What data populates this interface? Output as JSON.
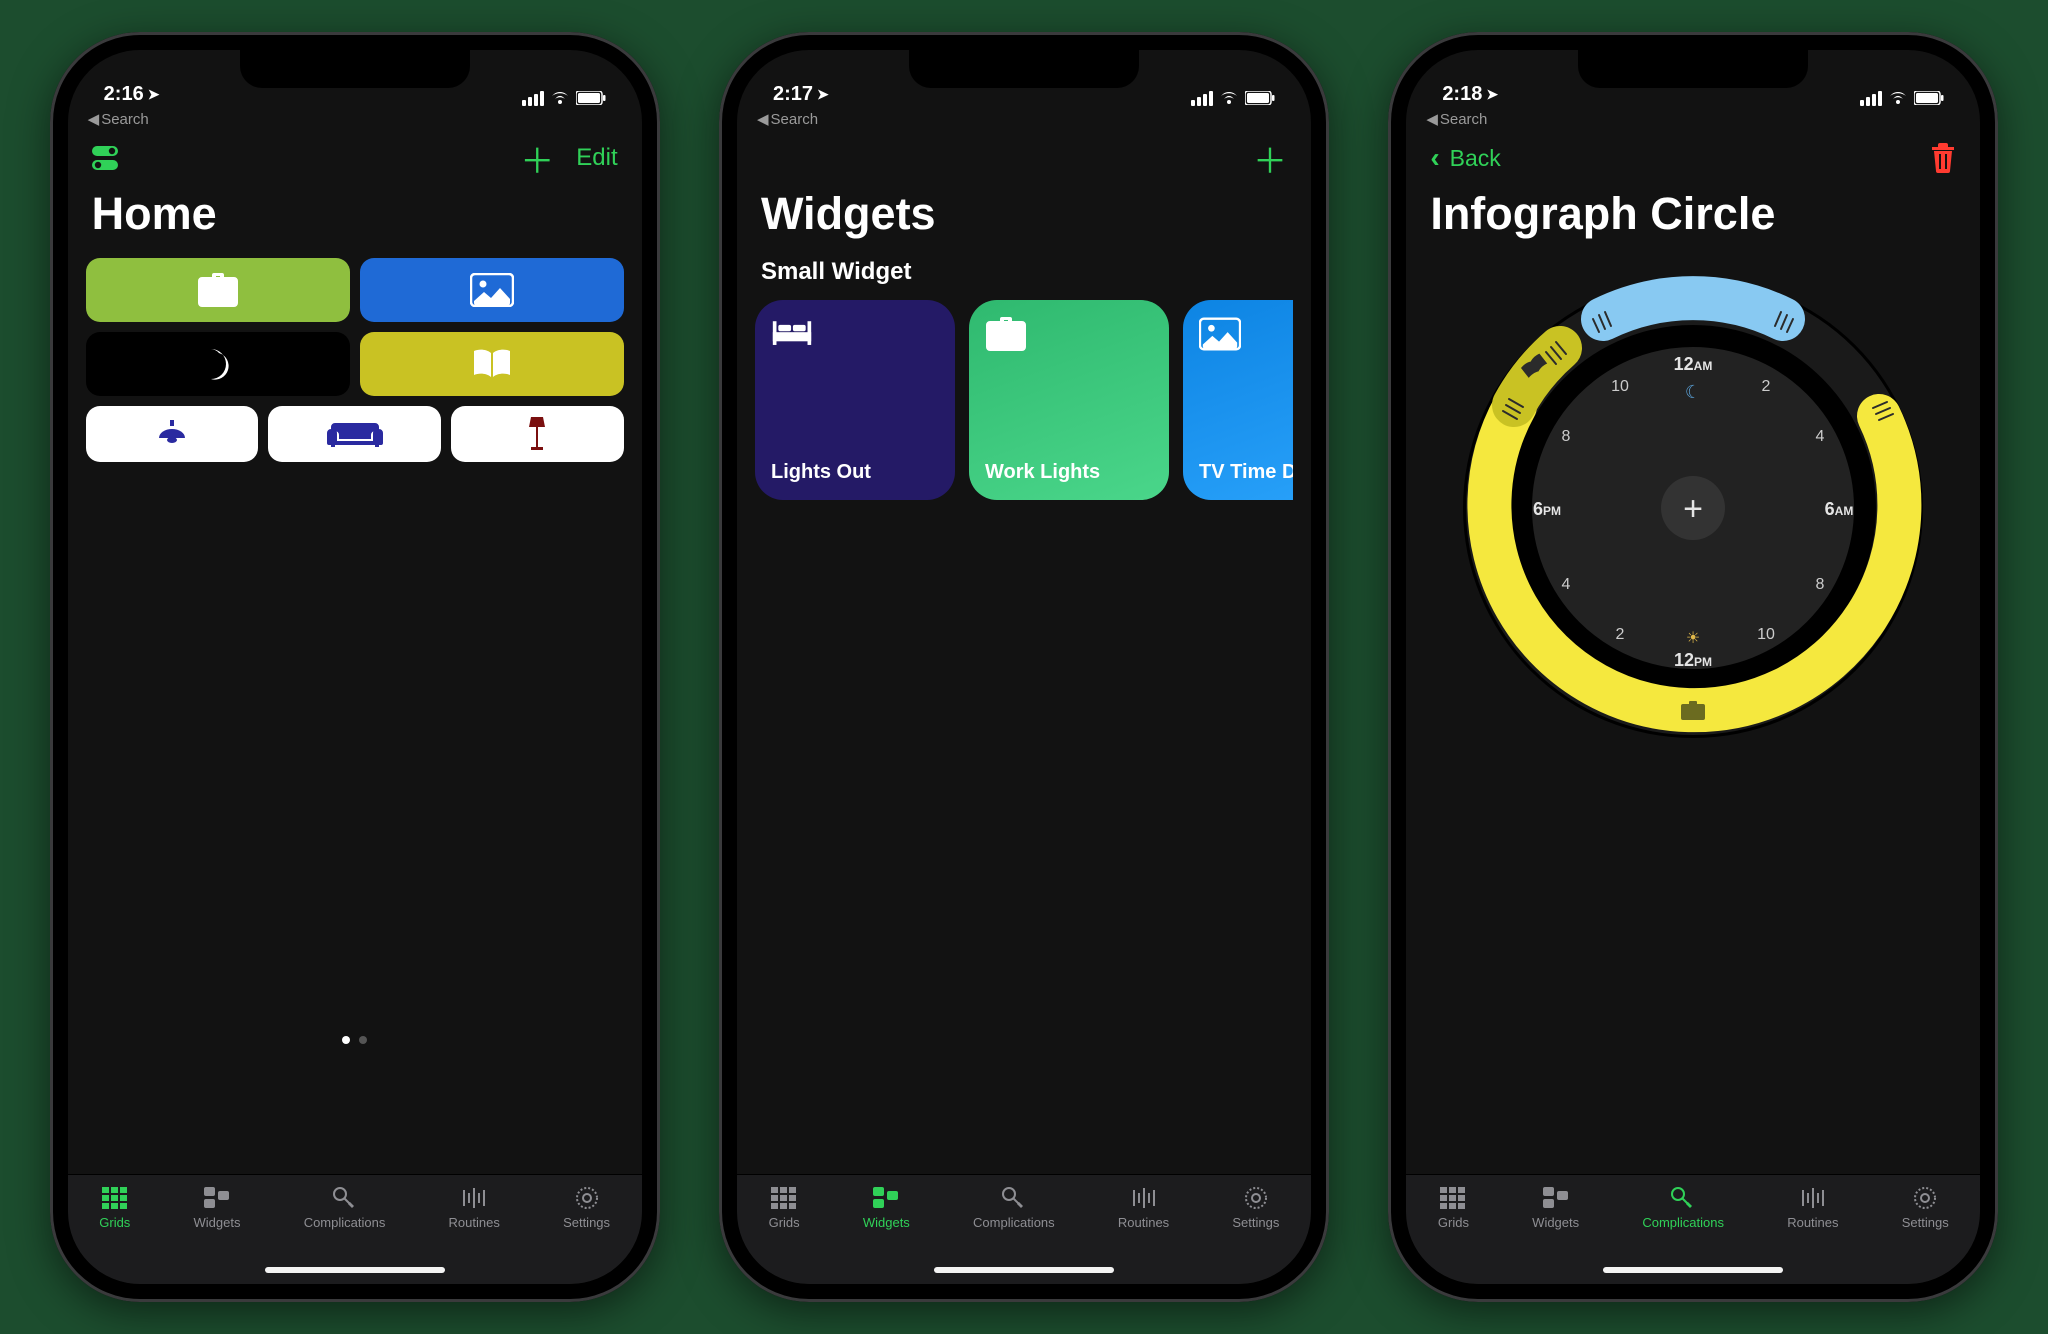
{
  "accent": "#30d158",
  "status": {
    "back_breadcrumb": "Search",
    "location_glyph": "➤"
  },
  "tabs": [
    {
      "id": "grids",
      "label": "Grids"
    },
    {
      "id": "widgets",
      "label": "Widgets"
    },
    {
      "id": "complications",
      "label": "Complications"
    },
    {
      "id": "routines",
      "label": "Routines"
    },
    {
      "id": "settings",
      "label": "Settings"
    }
  ],
  "screen1": {
    "time": "2:16",
    "title": "Home",
    "edit_label": "Edit",
    "active_tab": "grids",
    "tiles": [
      {
        "icon": "briefcase",
        "bg": "#8fbf3f",
        "fg": "#ffffff"
      },
      {
        "icon": "picture",
        "bg": "#1f6ad6",
        "fg": "#ffffff"
      },
      {
        "icon": "moon",
        "bg": "#000000",
        "fg": "#ffffff"
      },
      {
        "icon": "book",
        "bg": "#c9c223",
        "fg": "#ffffff"
      }
    ],
    "small_tiles": [
      {
        "icon": "lamp-ceiling",
        "fg": "#2a2aa0"
      },
      {
        "icon": "couch",
        "fg": "#2a2aa0"
      },
      {
        "icon": "lamp-floor",
        "fg": "#7a0f0f"
      }
    ],
    "page_index": 0,
    "page_count": 2
  },
  "screen2": {
    "time": "2:17",
    "title": "Widgets",
    "section": "Small Widget",
    "active_tab": "widgets",
    "widgets": [
      {
        "label": "Lights Out",
        "icon": "bed",
        "bg": "#241a66"
      },
      {
        "label": "Work Lights",
        "icon": "briefcase",
        "bg": "#38c57a"
      },
      {
        "label": "TV Time D",
        "icon": "picture",
        "bg": "#1693ef"
      }
    ]
  },
  "screen3": {
    "time": "2:18",
    "back_label": "Back",
    "title": "Infograph Circle",
    "active_tab": "complications",
    "dial": {
      "top_label": "12",
      "top_suffix": "AM",
      "bottom_label": "12",
      "bottom_suffix": "PM",
      "left_label": "6",
      "left_suffix": "PM",
      "right_label": "6",
      "right_suffix": "AM",
      "tick_2": "2",
      "tick_4": "4",
      "tick_8": "8",
      "tick_10": "10",
      "arcs": [
        {
          "color": "#88c9f2",
          "icon": "grip"
        },
        {
          "color": "#c9c223",
          "icon": "book"
        },
        {
          "color": "#f5e83e",
          "icon": "briefcase"
        }
      ],
      "center_glyph": "＋",
      "moon_glyph": "☾",
      "sun_glyph": "☀"
    }
  }
}
